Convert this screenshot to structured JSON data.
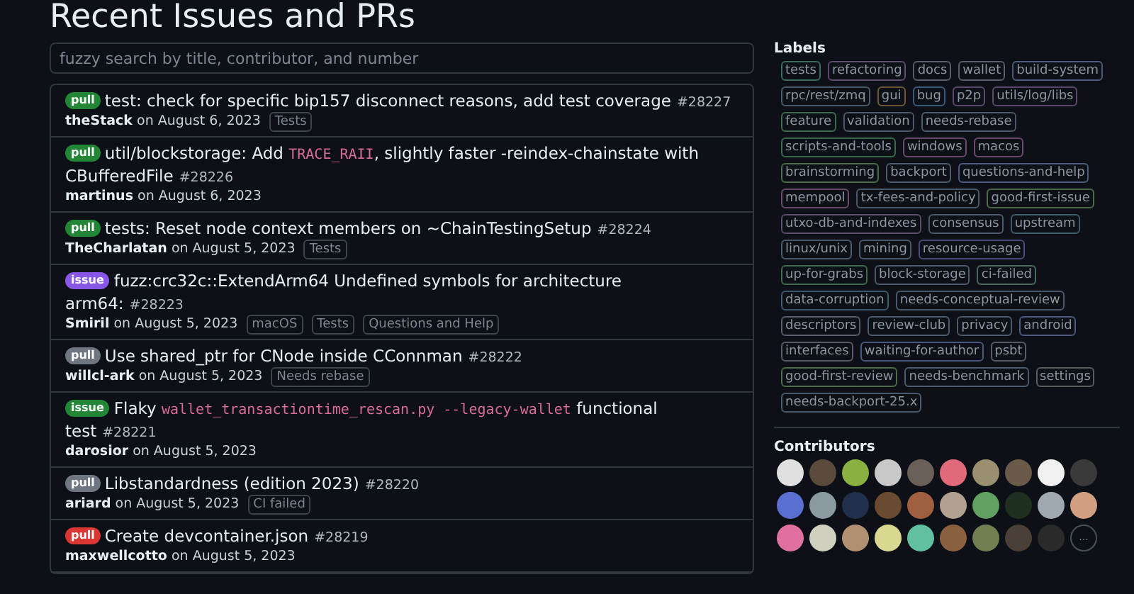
{
  "page": {
    "title": "Recent Issues and PRs"
  },
  "search": {
    "placeholder": "fuzzy search by title, contributor, and number"
  },
  "items": [
    {
      "badge": {
        "text": "pull",
        "color": "#238636"
      },
      "title": [
        {
          "text": "test: check for specific bip157 disconnect reasons, add test coverage",
          "code": false
        }
      ],
      "number": "#28227",
      "author": "theStack",
      "date": "on August 6, 2023",
      "labels": [
        "Tests"
      ]
    },
    {
      "badge": {
        "text": "pull",
        "color": "#238636"
      },
      "title": [
        {
          "text": "util/blockstorage: Add ",
          "code": false
        },
        {
          "text": "TRACE_RAII",
          "code": true
        },
        {
          "text": ", slightly faster -reindex-chainstate with CBufferedFile",
          "code": false
        }
      ],
      "number": "#28226",
      "author": "martinus",
      "date": "on August 6, 2023"
    },
    {
      "badge": {
        "text": "pull",
        "color": "#238636"
      },
      "title": [
        {
          "text": "tests: Reset node context members on ~ChainTestingSetup",
          "code": false
        }
      ],
      "number": "#28224",
      "author": "TheCharlatan",
      "date": "on August 5, 2023",
      "labels": [
        "Tests"
      ]
    },
    {
      "badge": {
        "text": "issue",
        "color": "#8957e5"
      },
      "title": [
        {
          "text": "fuzz:crc32c::ExtendArm64 Undefined symbols for architecture arm64:",
          "code": false
        }
      ],
      "number": "#28223",
      "author": "Smiril",
      "date": "on August 5, 2023",
      "labels": [
        "macOS",
        "Tests",
        "Questions and Help"
      ]
    },
    {
      "badge": {
        "text": "pull",
        "color": "#6e7681"
      },
      "title": [
        {
          "text": "Use shared_ptr for CNode inside CConnman",
          "code": false
        }
      ],
      "number": "#28222",
      "author": "willcl-ark",
      "date": "on August 5, 2023",
      "labels": [
        "Needs rebase"
      ]
    },
    {
      "badge": {
        "text": "issue",
        "color": "#238636"
      },
      "title": [
        {
          "text": "Flaky ",
          "code": false
        },
        {
          "text": "wallet_transactiontime_rescan.py --legacy-wallet",
          "code": true
        },
        {
          "text": " functional test",
          "code": false
        }
      ],
      "number": "#28221",
      "author": "darosior",
      "date": "on August 5, 2023"
    },
    {
      "badge": {
        "text": "pull",
        "color": "#6e7681"
      },
      "title": [
        {
          "text": "Libstandardness (edition 2023)",
          "code": false
        }
      ],
      "number": "#28220",
      "author": "ariard",
      "date": "on August 5, 2023",
      "labels": [
        "CI failed"
      ]
    },
    {
      "badge": {
        "text": "pull",
        "color": "#da3633"
      },
      "title": [
        {
          "text": "Create devcontainer.json",
          "code": false
        }
      ],
      "number": "#28219",
      "author": "maxwellcotto",
      "date": "on August 5, 2023"
    }
  ],
  "labels": {
    "heading": "Labels",
    "items": [
      {
        "text": "tests",
        "color": "#3a6a5a"
      },
      {
        "text": "refactoring",
        "color": "#5a4a6a"
      },
      {
        "text": "docs",
        "color": "#5a5a6a"
      },
      {
        "text": "wallet",
        "color": "#5a5a6a"
      },
      {
        "text": "build-system",
        "color": "#4a5a7a"
      },
      {
        "text": "rpc/rest/zmq",
        "color": "#4a5a6a"
      },
      {
        "text": "gui",
        "color": "#6a5a3a"
      },
      {
        "text": "bug",
        "color": "#3a5a7a"
      },
      {
        "text": "p2p",
        "color": "#5a4a6a"
      },
      {
        "text": "utils/log/libs",
        "color": "#5a4a6a"
      },
      {
        "text": "feature",
        "color": "#3a6a4a"
      },
      {
        "text": "validation",
        "color": "#4a5a6a"
      },
      {
        "text": "needs-rebase",
        "color": "#4a5a6a"
      },
      {
        "text": "scripts-and-tools",
        "color": "#3a6a4a"
      },
      {
        "text": "windows",
        "color": "#6a4a6a"
      },
      {
        "text": "macos",
        "color": "#6a4a6a"
      },
      {
        "text": "brainstorming",
        "color": "#4a6a4a"
      },
      {
        "text": "backport",
        "color": "#4a5a6a"
      },
      {
        "text": "questions-and-help",
        "color": "#4a5a7a"
      },
      {
        "text": "mempool",
        "color": "#6a4a6a"
      },
      {
        "text": "tx-fees-and-policy",
        "color": "#4a5a6a"
      },
      {
        "text": "good-first-issue",
        "color": "#4a6a4a"
      },
      {
        "text": "utxo-db-and-indexes",
        "color": "#5a4a6a"
      },
      {
        "text": "consensus",
        "color": "#4a5a6a"
      },
      {
        "text": "upstream",
        "color": "#3a5a6a"
      },
      {
        "text": "linux/unix",
        "color": "#4a5a6a"
      },
      {
        "text": "mining",
        "color": "#4a5a6a"
      },
      {
        "text": "resource-usage",
        "color": "#4a4a7a"
      },
      {
        "text": "up-for-grabs",
        "color": "#3a6a4a"
      },
      {
        "text": "block-storage",
        "color": "#4a5a6a"
      },
      {
        "text": "ci-failed",
        "color": "#4a6a5a"
      },
      {
        "text": "data-corruption",
        "color": "#3a5a6a"
      },
      {
        "text": "needs-conceptual-review",
        "color": "#4a5a6a"
      },
      {
        "text": "descriptors",
        "color": "#5a5a6a"
      },
      {
        "text": "review-club",
        "color": "#4a5a6a"
      },
      {
        "text": "privacy",
        "color": "#4a5a6a"
      },
      {
        "text": "android",
        "color": "#4a5a7a"
      },
      {
        "text": "interfaces",
        "color": "#5a5a6a"
      },
      {
        "text": "waiting-for-author",
        "color": "#4a5a7a"
      },
      {
        "text": "psbt",
        "color": "#5a5a6a"
      },
      {
        "text": "good-first-review",
        "color": "#4a6a4a"
      },
      {
        "text": "needs-benchmark",
        "color": "#4a5a6a"
      },
      {
        "text": "settings",
        "color": "#5a5a5a"
      },
      {
        "text": "needs-backport-25.x",
        "color": "#4a5a6a"
      }
    ]
  },
  "contributors": {
    "heading": "Contributors",
    "avatars": [
      {
        "color": "#e0e0e0"
      },
      {
        "color": "#5a4a3a"
      },
      {
        "color": "#8ab040"
      },
      {
        "color": "#c8c8c8"
      },
      {
        "color": "#6a6058"
      },
      {
        "color": "#e06a7a"
      },
      {
        "color": "#9a9070"
      },
      {
        "color": "#6a5a4a"
      },
      {
        "color": "#f0f0f0"
      },
      {
        "color": "#3a3a3a"
      },
      {
        "color": "#5a70d0"
      },
      {
        "color": "#8a9aa0"
      },
      {
        "color": "#20304a"
      },
      {
        "color": "#6a4a30"
      },
      {
        "color": "#a06040"
      },
      {
        "color": "#b0a090"
      },
      {
        "color": "#60a060"
      },
      {
        "color": "#203020"
      },
      {
        "color": "#a0a8b0"
      },
      {
        "color": "#d0a080"
      },
      {
        "color": "#e070a0"
      },
      {
        "color": "#d0d0c0"
      },
      {
        "color": "#b09070"
      },
      {
        "color": "#d8d890"
      },
      {
        "color": "#60c0a0"
      },
      {
        "color": "#8a6040"
      },
      {
        "color": "#708050"
      },
      {
        "color": "#4a4038"
      },
      {
        "color": "#2a2a2a"
      }
    ],
    "more": "…"
  }
}
